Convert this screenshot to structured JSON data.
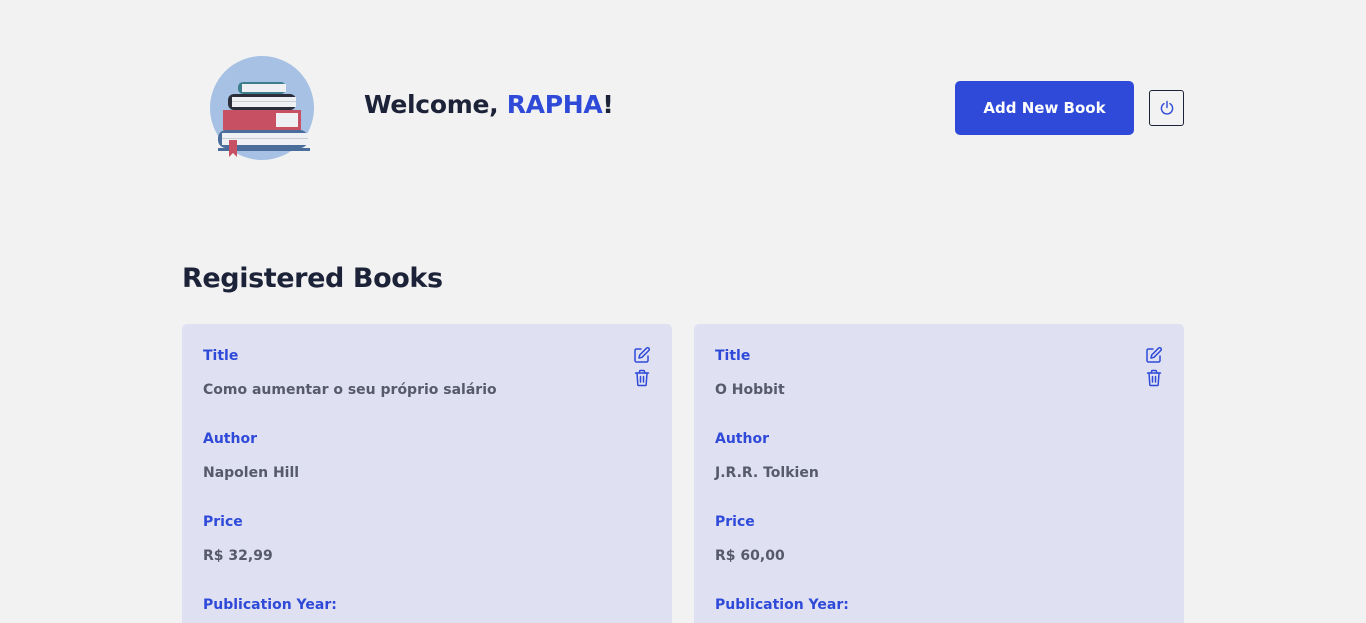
{
  "header": {
    "logo_icon": "stacked-books-icon",
    "welcome_prefix": "Welcome, ",
    "username": "RAPHA",
    "welcome_suffix": "!",
    "add_button_label": "Add New Book",
    "logout_icon": "power-icon"
  },
  "main": {
    "section_title": "Registered Books",
    "books": [
      {
        "title_label": "Title",
        "title": "Como aumentar o seu próprio salário",
        "author_label": "Author",
        "author": "Napolen Hill",
        "price_label": "Price",
        "price": "R$ 32,99",
        "year_label": "Publication Year:"
      },
      {
        "title_label": "Title",
        "title": "O Hobbit",
        "author_label": "Author",
        "author": "J.R.R. Tolkien",
        "price_label": "Price",
        "price": "R$ 60,00",
        "year_label": "Publication Year:"
      }
    ]
  },
  "colors": {
    "accent": "#2f4ad8",
    "background": "#f2f2f2",
    "card": "#dfe0f2",
    "heading": "#1c2237",
    "value_text": "#565a6b"
  }
}
